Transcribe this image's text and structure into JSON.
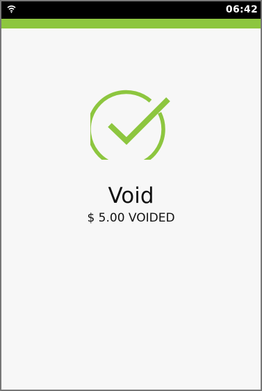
{
  "status_bar": {
    "time": "06:42",
    "wifi_icon": "wifi-icon"
  },
  "result": {
    "icon": "check-circle-icon",
    "title": "Void",
    "subtitle": "$ 5.00 VOIDED"
  },
  "colors": {
    "accent": "#8dc63f",
    "status_bar_background": "#000000",
    "background": "#f7f7f7",
    "text": "#111111"
  }
}
